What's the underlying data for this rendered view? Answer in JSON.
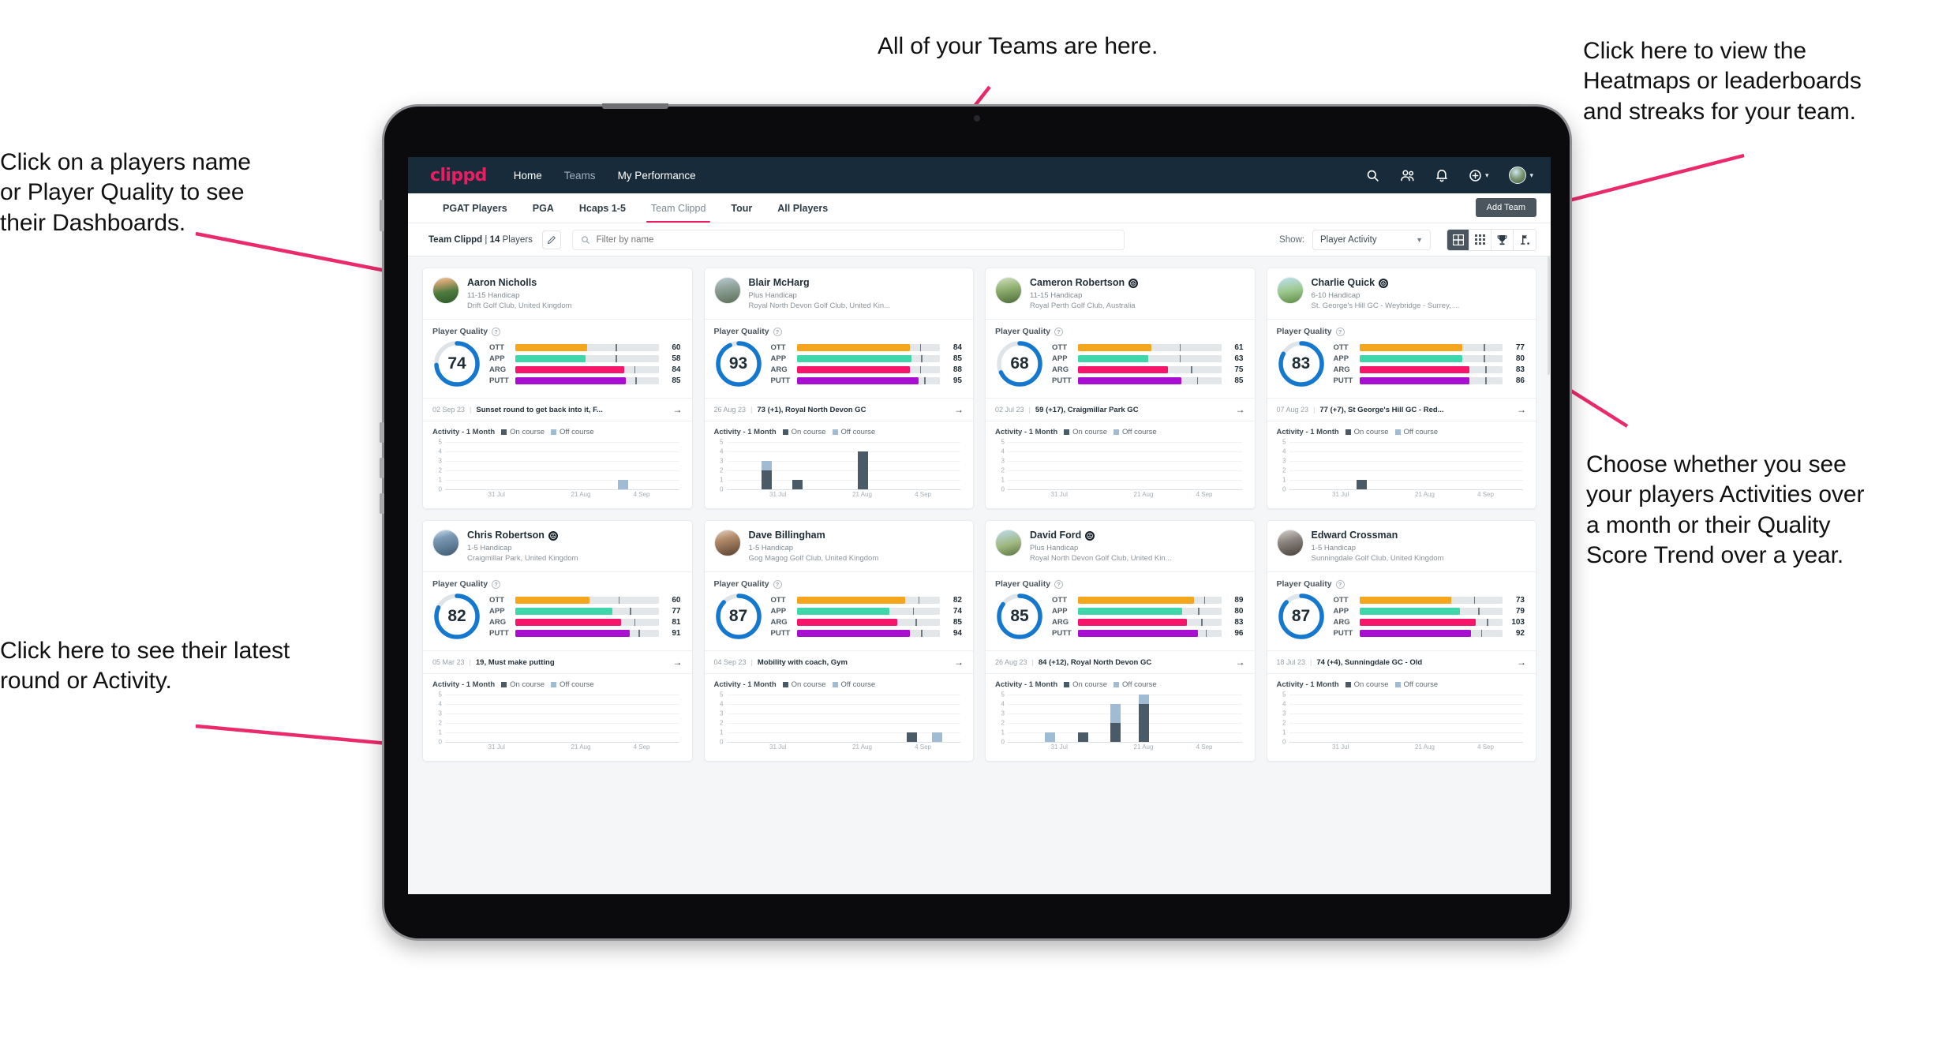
{
  "annotations": [
    {
      "id": "teams",
      "text": "All of your Teams are here."
    },
    {
      "id": "heatmaps",
      "text": "Click here to view the\nHeatmaps or leaderboards\nand streaks for your team."
    },
    {
      "id": "players-name",
      "text": "Click on a players name\nor Player Quality to see\ntheir Dashboards."
    },
    {
      "id": "activity-choice",
      "text": "Choose whether you see\nyour players Activities over\na month or their Quality\nScore Trend over a year."
    },
    {
      "id": "latest-round",
      "text": "Click here to see their latest\nround or Activity."
    }
  ],
  "topnav": {
    "logo": "clippd",
    "links": [
      {
        "label": "Home",
        "active": true
      },
      {
        "label": "Teams",
        "active": false
      },
      {
        "label": "My Performance",
        "active": true
      }
    ],
    "icons": [
      "search-icon",
      "people-icon",
      "bell-icon",
      "plus-circle-icon",
      "avatar"
    ]
  },
  "tabs": [
    {
      "label": "PGAT Players",
      "active": false
    },
    {
      "label": "PGA",
      "active": false
    },
    {
      "label": "Hcaps 1-5",
      "active": false
    },
    {
      "label": "Team Clippd",
      "active": true
    },
    {
      "label": "Tour",
      "active": false
    },
    {
      "label": "All Players",
      "active": false
    }
  ],
  "add_team_label": "Add Team",
  "filterbar": {
    "team_name": "Team Clippd",
    "separator": "|",
    "player_count": "14",
    "players_word": "Players",
    "edit_icon": "pencil-icon",
    "search_placeholder": "Filter by name",
    "search_value": "",
    "show_label": "Show:",
    "show_value": "Player Activity",
    "show_options": [
      "Player Activity",
      "Quality Score Trend"
    ],
    "view_buttons": [
      {
        "icon": "grid-large-icon",
        "selected": true
      },
      {
        "icon": "grid-small-icon",
        "selected": false
      },
      {
        "icon": "trophy-icon",
        "selected": false
      },
      {
        "icon": "golf-flag-icon",
        "selected": false
      }
    ]
  },
  "card_labels": {
    "player_quality": "Player Quality",
    "activity": "Activity - 1 Month",
    "legend_on": "On course",
    "legend_off": "Off course",
    "metric_names": [
      "OTT",
      "APP",
      "ARG",
      "PUTT"
    ]
  },
  "metric_colors": {
    "OTT": "#f5a61d",
    "APP": "#3fd6ab",
    "ARG": "#f5166b",
    "PUTT": "#a80fd0",
    "ring": "#1578cf",
    "ring_track": "#dfe4e8",
    "on_course": "#4a5a66",
    "off_course": "#9fbcd4",
    "brand": "#ea1d62",
    "navbar": "#172b3a",
    "annotation_arrow": "#ea2a6a"
  },
  "chart_data": {
    "type": "bar",
    "title": "Activity - 1 Month",
    "ylim": [
      0,
      5
    ],
    "yticks": [
      0,
      1,
      2,
      3,
      4,
      5
    ],
    "xlabel": "",
    "ylabel": "",
    "xtick_labels": [
      "31 Jul",
      "21 Aug",
      "4 Sep"
    ],
    "legend": [
      "On course",
      "Off course"
    ],
    "legend_position": "top",
    "grid": true,
    "stacked": true,
    "panels": [
      {
        "player": "Aaron Nicholls",
        "bars": [
          {
            "x": 0.74,
            "on": 0,
            "off": 1
          }
        ]
      },
      {
        "player": "Blair McHarg",
        "bars": [
          {
            "x": 0.15,
            "on": 2,
            "off": 1
          },
          {
            "x": 0.28,
            "on": 1,
            "off": 0
          },
          {
            "x": 0.56,
            "on": 4,
            "off": 0
          }
        ]
      },
      {
        "player": "Cameron Robertson",
        "bars": []
      },
      {
        "player": "Charlie Quick",
        "bars": [
          {
            "x": 0.29,
            "on": 1,
            "off": 0
          }
        ]
      },
      {
        "player": "Chris Robertson",
        "bars": []
      },
      {
        "player": "Dave Billingham",
        "bars": [
          {
            "x": 0.77,
            "on": 1,
            "off": 0
          },
          {
            "x": 0.88,
            "on": 0,
            "off": 1
          }
        ]
      },
      {
        "player": "David Ford",
        "bars": [
          {
            "x": 0.16,
            "on": 0,
            "off": 1
          },
          {
            "x": 0.3,
            "on": 1,
            "off": 0
          },
          {
            "x": 0.44,
            "on": 2,
            "off": 2
          },
          {
            "x": 0.56,
            "on": 4,
            "off": 1
          }
        ]
      },
      {
        "player": "Edward Crossman",
        "bars": []
      }
    ]
  },
  "players": [
    {
      "name": "Aaron Nicholls",
      "verified": false,
      "avatar_class": "pa1",
      "handicap": "11-15 Handicap",
      "club": "Drift Golf Club, United Kingdom",
      "quality": 74,
      "metrics": [
        {
          "label": "OTT",
          "value": 60,
          "fill": 0.5,
          "tick": 0.7
        },
        {
          "label": "APP",
          "value": 58,
          "fill": 0.49,
          "tick": 0.7
        },
        {
          "label": "ARG",
          "value": 84,
          "fill": 0.76,
          "tick": 0.83
        },
        {
          "label": "PUTT",
          "value": 85,
          "fill": 0.77,
          "tick": 0.84
        }
      ],
      "round_date": "02 Sep 23",
      "round_text": "Sunset round to get back into it, F..."
    },
    {
      "name": "Blair McHarg",
      "verified": false,
      "avatar_class": "pa2",
      "handicap": "Plus Handicap",
      "club": "Royal North Devon Golf Club, United Kin...",
      "quality": 93,
      "metrics": [
        {
          "label": "OTT",
          "value": 84,
          "fill": 0.79,
          "tick": 0.86
        },
        {
          "label": "APP",
          "value": 85,
          "fill": 0.8,
          "tick": 0.87
        },
        {
          "label": "ARG",
          "value": 88,
          "fill": 0.79,
          "tick": 0.86
        },
        {
          "label": "PUTT",
          "value": 95,
          "fill": 0.85,
          "tick": 0.89
        }
      ],
      "round_date": "26 Aug 23",
      "round_text": "73 (+1), Royal North Devon GC"
    },
    {
      "name": "Cameron Robertson",
      "verified": true,
      "avatar_class": "pa3",
      "handicap": "11-15 Handicap",
      "club": "Royal Perth Golf Club, Australia",
      "quality": 68,
      "metrics": [
        {
          "label": "OTT",
          "value": 61,
          "fill": 0.51,
          "tick": 0.71
        },
        {
          "label": "APP",
          "value": 63,
          "fill": 0.49,
          "tick": 0.71
        },
        {
          "label": "ARG",
          "value": 75,
          "fill": 0.63,
          "tick": 0.79
        },
        {
          "label": "PUTT",
          "value": 85,
          "fill": 0.72,
          "tick": 0.83
        }
      ],
      "round_date": "02 Jul 23",
      "round_text": "59 (+17), Craigmillar Park GC"
    },
    {
      "name": "Charlie Quick",
      "verified": true,
      "avatar_class": "pa4",
      "handicap": "6-10 Handicap",
      "club": "St. George's Hill GC - Weybridge - Surrey, ...",
      "quality": 83,
      "metrics": [
        {
          "label": "OTT",
          "value": 77,
          "fill": 0.72,
          "tick": 0.87
        },
        {
          "label": "APP",
          "value": 80,
          "fill": 0.72,
          "tick": 0.87
        },
        {
          "label": "ARG",
          "value": 83,
          "fill": 0.77,
          "tick": 0.88
        },
        {
          "label": "PUTT",
          "value": 86,
          "fill": 0.77,
          "tick": 0.88
        }
      ],
      "round_date": "07 Aug 23",
      "round_text": "77 (+7), St George's Hill GC - Red..."
    },
    {
      "name": "Chris Robertson",
      "verified": true,
      "avatar_class": "pa5",
      "handicap": "1-5 Handicap",
      "club": "Craigmillar Park, United Kingdom",
      "quality": 82,
      "metrics": [
        {
          "label": "OTT",
          "value": 60,
          "fill": 0.52,
          "tick": 0.72
        },
        {
          "label": "APP",
          "value": 77,
          "fill": 0.68,
          "tick": 0.8
        },
        {
          "label": "ARG",
          "value": 81,
          "fill": 0.74,
          "tick": 0.83
        },
        {
          "label": "PUTT",
          "value": 91,
          "fill": 0.8,
          "tick": 0.86
        }
      ],
      "round_date": "05 Mar 23",
      "round_text": "19, Must make putting"
    },
    {
      "name": "Dave Billingham",
      "verified": false,
      "avatar_class": "pa6",
      "handicap": "1-5 Handicap",
      "club": "Gog Magog Golf Club, United Kingdom",
      "quality": 87,
      "metrics": [
        {
          "label": "OTT",
          "value": 82,
          "fill": 0.76,
          "tick": 0.85
        },
        {
          "label": "APP",
          "value": 74,
          "fill": 0.65,
          "tick": 0.81
        },
        {
          "label": "ARG",
          "value": 85,
          "fill": 0.7,
          "tick": 0.83
        },
        {
          "label": "PUTT",
          "value": 94,
          "fill": 0.79,
          "tick": 0.87
        }
      ],
      "round_date": "04 Sep 23",
      "round_text": "Mobility with coach, Gym"
    },
    {
      "name": "David Ford",
      "verified": true,
      "avatar_class": "pa7",
      "handicap": "Plus Handicap",
      "club": "Royal North Devon Golf Club, United Kin...",
      "quality": 85,
      "metrics": [
        {
          "label": "OTT",
          "value": 89,
          "fill": 0.81,
          "tick": 0.88
        },
        {
          "label": "APP",
          "value": 80,
          "fill": 0.73,
          "tick": 0.84
        },
        {
          "label": "ARG",
          "value": 83,
          "fill": 0.76,
          "tick": 0.86
        },
        {
          "label": "PUTT",
          "value": 96,
          "fill": 0.84,
          "tick": 0.89
        }
      ],
      "round_date": "26 Aug 23",
      "round_text": "84 (+12), Royal North Devon GC"
    },
    {
      "name": "Edward Crossman",
      "verified": false,
      "avatar_class": "pa8",
      "handicap": "1-5 Handicap",
      "club": "Sunningdale Golf Club, United Kingdom",
      "quality": 87,
      "metrics": [
        {
          "label": "OTT",
          "value": 73,
          "fill": 0.64,
          "tick": 0.8
        },
        {
          "label": "APP",
          "value": 79,
          "fill": 0.7,
          "tick": 0.83
        },
        {
          "label": "ARG",
          "value": 103,
          "fill": 0.81,
          "tick": 0.89
        },
        {
          "label": "PUTT",
          "value": 92,
          "fill": 0.78,
          "tick": 0.85
        }
      ],
      "round_date": "18 Jul 23",
      "round_text": "74 (+4), Sunningdale GC - Old"
    }
  ]
}
